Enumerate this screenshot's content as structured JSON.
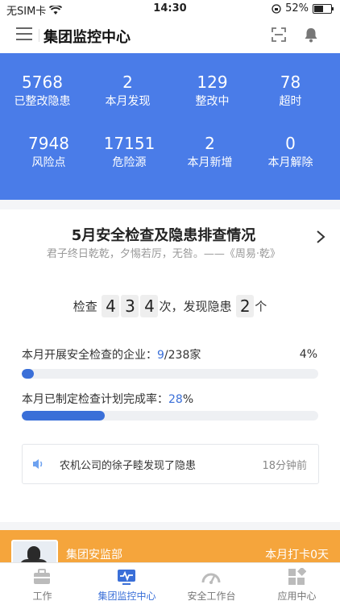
{
  "status_bar": {
    "carrier": "无SIM卡",
    "time": "14:30",
    "battery": "52%"
  },
  "nav": {
    "title": "集团监控中心"
  },
  "stats": [
    {
      "num": "5768",
      "label": "已整改隐患"
    },
    {
      "num": "2",
      "label": "本月发现"
    },
    {
      "num": "129",
      "label": "整改中"
    },
    {
      "num": "78",
      "label": "超时"
    },
    {
      "num": "7948",
      "label": "风险点"
    },
    {
      "num": "17151",
      "label": "危险源"
    },
    {
      "num": "2",
      "label": "本月新增"
    },
    {
      "num": "0",
      "label": "本月解除"
    }
  ],
  "card": {
    "title": "5月安全检查及隐患排查情况",
    "subtitle": "君子终日乾乾，夕惕若厉，无咎。——《周易·乾》",
    "count": {
      "prefix": "检查",
      "d1": "4",
      "d2": "3",
      "d3": "4",
      "middle": "次，发现隐患",
      "h1": "2",
      "suffix": "个"
    },
    "row1": {
      "label": "本月开展安全检查的企业：",
      "value": "9",
      "total": "/238家",
      "pct": "4%",
      "fill": 0.04
    },
    "row2": {
      "label": "本月已制定检查计划完成率：",
      "value": "28",
      "unit": "%",
      "fill": 0.28
    },
    "notice": {
      "message": "农机公司的徐子睦发现了隐患",
      "time": "18分钟前"
    }
  },
  "orange": {
    "dept": "集团安监部",
    "punch": "本月打卡0天"
  },
  "tabs": [
    {
      "label": "工作",
      "icon": "briefcase-icon"
    },
    {
      "label": "集团监控中心",
      "icon": "monitor-icon"
    },
    {
      "label": "安全工作台",
      "icon": "gauge-icon"
    },
    {
      "label": "应用中心",
      "icon": "apps-grid-icon"
    }
  ],
  "colors": {
    "primary": "#4a7ce8",
    "accent": "#3a6fd8",
    "orange": "#f5a53c"
  }
}
